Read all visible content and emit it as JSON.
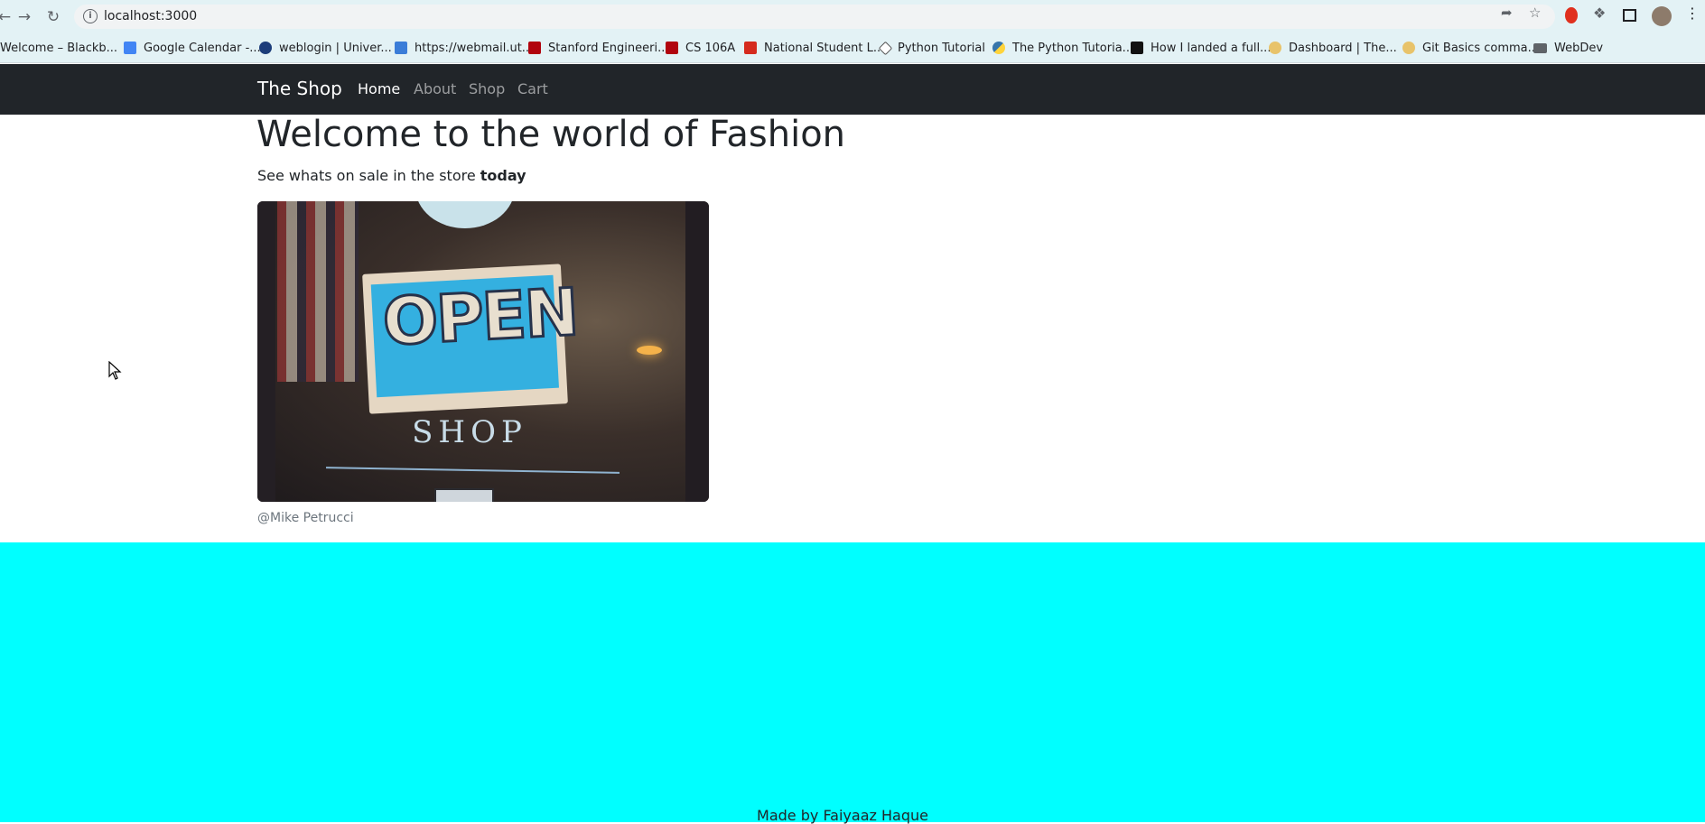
{
  "browser": {
    "url": "localhost:3000",
    "back_icon": "arrow-left",
    "forward_icon": "arrow-right",
    "reload_icon": "reload",
    "bookmarks": [
      {
        "label": "Welcome – Blackb...",
        "color": "#1a1a1a"
      },
      {
        "label": "Google Calendar -...",
        "color": "#4285f4"
      },
      {
        "label": "weblogin | Univer...",
        "color": "#1c3d7a"
      },
      {
        "label": "https://webmail.ut...",
        "color": "#3b7dd8"
      },
      {
        "label": "Stanford Engineeri...",
        "color": "#b1040e"
      },
      {
        "label": "CS 106A",
        "color": "#b1040e"
      },
      {
        "label": "National Student L...",
        "color": "#d52b1e"
      },
      {
        "label": "Python Tutorial",
        "color": "#555555"
      },
      {
        "label": "The Python Tutoria...",
        "color": "#3776ab"
      },
      {
        "label": "How I landed a full...",
        "color": "#111111"
      },
      {
        "label": "Dashboard | The...",
        "color": "#e8c36a"
      },
      {
        "label": "Git Basics comma...",
        "color": "#e8c36a"
      },
      {
        "label": "WebDev",
        "color": "#5f6368"
      }
    ]
  },
  "navbar": {
    "brand": "The Shop",
    "links": [
      {
        "label": "Home",
        "active": true
      },
      {
        "label": "About",
        "active": false
      },
      {
        "label": "Shop",
        "active": false
      },
      {
        "label": "Cart",
        "active": false
      }
    ]
  },
  "main": {
    "heading": "Welcome to the world of Fashion",
    "lead_text": "See whats on sale in the store ",
    "lead_bold": "today",
    "image": {
      "sign_text": "OPEN",
      "shop_text": "SHOP"
    },
    "credit": "@Mike Petrucci"
  },
  "footer": {
    "text": "Made by Faiyaaz Haque",
    "background": "#00ffff"
  }
}
